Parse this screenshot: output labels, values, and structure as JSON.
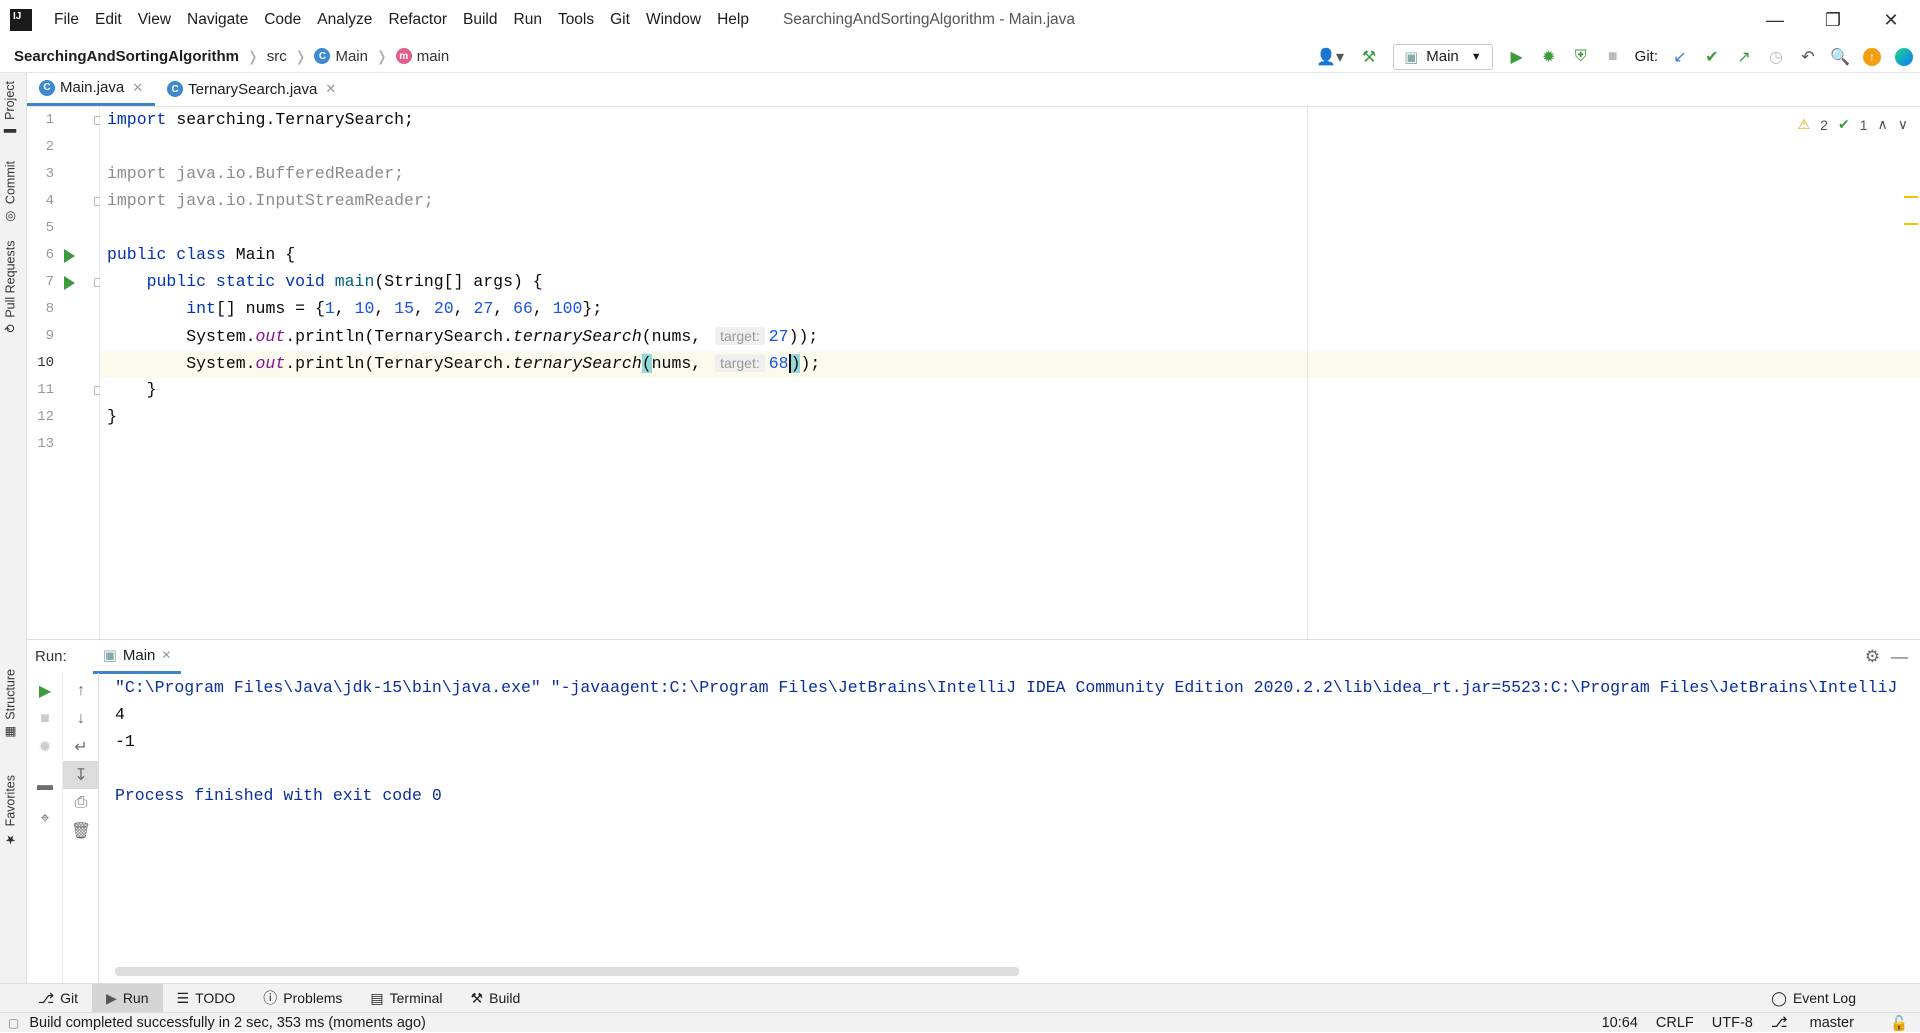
{
  "menubar": {
    "items": [
      "File",
      "Edit",
      "View",
      "Navigate",
      "Code",
      "Analyze",
      "Refactor",
      "Build",
      "Run",
      "Tools",
      "Git",
      "Window",
      "Help"
    ],
    "window_title": "SearchingAndSortingAlgorithm - Main.java"
  },
  "navbar": {
    "project": "SearchingAndSortingAlgorithm",
    "folder": "src",
    "class": "Main",
    "method": "main",
    "run_config": "Main",
    "git_label": "Git:"
  },
  "left_strip": [
    "Project",
    "Commit",
    "Pull Requests",
    "Structure",
    "Favorites"
  ],
  "tabs": [
    {
      "label": "Main.java"
    },
    {
      "label": "TernarySearch.java"
    }
  ],
  "inspections": {
    "warnings": "2",
    "ok": "1"
  },
  "code": {
    "line_numbers": [
      "1",
      "2",
      "3",
      "4",
      "5",
      "6",
      "7",
      "8",
      "9",
      "10",
      "11",
      "12",
      "13"
    ],
    "l1_kw": "import",
    "l1_rest": " searching.TernarySearch;",
    "l3": "import java.io.BufferedReader;",
    "l4": "import java.io.InputStreamReader;",
    "l6_kw": "public class",
    "l6_rest": " Main {",
    "l7_kw": "public static void",
    "l7_fn": "main",
    "l7_rest": "(String[] args) {",
    "l8_kw": "int",
    "l8_a": "[] nums = {",
    "l8_nums": [
      "1",
      "10",
      "15",
      "20",
      "27",
      "66",
      "100"
    ],
    "l8_end": "};",
    "sys": "System.",
    "out": "out",
    "println": ".println(TernarySearch.",
    "ternary": "ternarySearch",
    "nums_arg": "nums, ",
    "hint_label": "target:",
    "l9_val": "27",
    "l9_end": "));",
    "l10_val_a": "68",
    "l10_end": ");",
    "l11": "}",
    "l12": "}"
  },
  "run_panel": {
    "label": "Run:",
    "tab": "Main",
    "command": "\"C:\\Program Files\\Java\\jdk-15\\bin\\java.exe\" \"-javaagent:C:\\Program Files\\JetBrains\\IntelliJ IDEA Community Edition 2020.2.2\\lib\\idea_rt.jar=5523:C:\\Program Files\\JetBrains\\IntelliJ",
    "out1": "4",
    "out2": "-1",
    "finish": "Process finished with exit code 0"
  },
  "bottom_tabs": [
    "Git",
    "Run",
    "TODO",
    "Problems",
    "Terminal",
    "Build"
  ],
  "event_log": "Event Log",
  "status": {
    "message": "Build completed successfully in 2 sec, 353 ms (moments ago)",
    "position": "10:64",
    "line_sep": "CRLF",
    "encoding": "UTF-8",
    "branch": "master"
  },
  "colors": {
    "accent": "#4083c9",
    "run_green": "#3d9a3e",
    "keyword": "#0033b3",
    "number": "#1750eb"
  }
}
